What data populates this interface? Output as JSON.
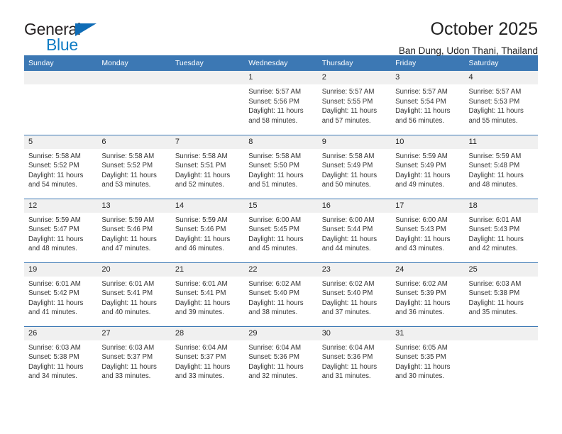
{
  "logo": {
    "word_one": "General",
    "word_two": "Blue",
    "triangle": "blue-triangle-icon",
    "accent_dark": "#231f20",
    "accent_blue": "#0f7cc4"
  },
  "header": {
    "title": "October 2025",
    "subtitle": "Ban Dung, Udon Thani, Thailand"
  },
  "theme": {
    "header_blue": "#3c78b4",
    "daynum_gray": "#f0f0f0",
    "text": "#333333"
  },
  "weekdays": [
    "Sunday",
    "Monday",
    "Tuesday",
    "Wednesday",
    "Thursday",
    "Friday",
    "Saturday"
  ],
  "weeks": [
    [
      {
        "day": "",
        "sunrise": "",
        "sunset": "",
        "daylight_line1": "",
        "daylight_line2": "",
        "empty": true
      },
      {
        "day": "",
        "sunrise": "",
        "sunset": "",
        "daylight_line1": "",
        "daylight_line2": "",
        "empty": true
      },
      {
        "day": "",
        "sunrise": "",
        "sunset": "",
        "daylight_line1": "",
        "daylight_line2": "",
        "empty": true
      },
      {
        "day": "1",
        "sunrise": "Sunrise: 5:57 AM",
        "sunset": "Sunset: 5:56 PM",
        "daylight_line1": "Daylight: 11 hours",
        "daylight_line2": "and 58 minutes.",
        "empty": false
      },
      {
        "day": "2",
        "sunrise": "Sunrise: 5:57 AM",
        "sunset": "Sunset: 5:55 PM",
        "daylight_line1": "Daylight: 11 hours",
        "daylight_line2": "and 57 minutes.",
        "empty": false
      },
      {
        "day": "3",
        "sunrise": "Sunrise: 5:57 AM",
        "sunset": "Sunset: 5:54 PM",
        "daylight_line1": "Daylight: 11 hours",
        "daylight_line2": "and 56 minutes.",
        "empty": false
      },
      {
        "day": "4",
        "sunrise": "Sunrise: 5:57 AM",
        "sunset": "Sunset: 5:53 PM",
        "daylight_line1": "Daylight: 11 hours",
        "daylight_line2": "and 55 minutes.",
        "empty": false
      }
    ],
    [
      {
        "day": "5",
        "sunrise": "Sunrise: 5:58 AM",
        "sunset": "Sunset: 5:52 PM",
        "daylight_line1": "Daylight: 11 hours",
        "daylight_line2": "and 54 minutes.",
        "empty": false
      },
      {
        "day": "6",
        "sunrise": "Sunrise: 5:58 AM",
        "sunset": "Sunset: 5:52 PM",
        "daylight_line1": "Daylight: 11 hours",
        "daylight_line2": "and 53 minutes.",
        "empty": false
      },
      {
        "day": "7",
        "sunrise": "Sunrise: 5:58 AM",
        "sunset": "Sunset: 5:51 PM",
        "daylight_line1": "Daylight: 11 hours",
        "daylight_line2": "and 52 minutes.",
        "empty": false
      },
      {
        "day": "8",
        "sunrise": "Sunrise: 5:58 AM",
        "sunset": "Sunset: 5:50 PM",
        "daylight_line1": "Daylight: 11 hours",
        "daylight_line2": "and 51 minutes.",
        "empty": false
      },
      {
        "day": "9",
        "sunrise": "Sunrise: 5:58 AM",
        "sunset": "Sunset: 5:49 PM",
        "daylight_line1": "Daylight: 11 hours",
        "daylight_line2": "and 50 minutes.",
        "empty": false
      },
      {
        "day": "10",
        "sunrise": "Sunrise: 5:59 AM",
        "sunset": "Sunset: 5:49 PM",
        "daylight_line1": "Daylight: 11 hours",
        "daylight_line2": "and 49 minutes.",
        "empty": false
      },
      {
        "day": "11",
        "sunrise": "Sunrise: 5:59 AM",
        "sunset": "Sunset: 5:48 PM",
        "daylight_line1": "Daylight: 11 hours",
        "daylight_line2": "and 48 minutes.",
        "empty": false
      }
    ],
    [
      {
        "day": "12",
        "sunrise": "Sunrise: 5:59 AM",
        "sunset": "Sunset: 5:47 PM",
        "daylight_line1": "Daylight: 11 hours",
        "daylight_line2": "and 48 minutes.",
        "empty": false
      },
      {
        "day": "13",
        "sunrise": "Sunrise: 5:59 AM",
        "sunset": "Sunset: 5:46 PM",
        "daylight_line1": "Daylight: 11 hours",
        "daylight_line2": "and 47 minutes.",
        "empty": false
      },
      {
        "day": "14",
        "sunrise": "Sunrise: 5:59 AM",
        "sunset": "Sunset: 5:46 PM",
        "daylight_line1": "Daylight: 11 hours",
        "daylight_line2": "and 46 minutes.",
        "empty": false
      },
      {
        "day": "15",
        "sunrise": "Sunrise: 6:00 AM",
        "sunset": "Sunset: 5:45 PM",
        "daylight_line1": "Daylight: 11 hours",
        "daylight_line2": "and 45 minutes.",
        "empty": false
      },
      {
        "day": "16",
        "sunrise": "Sunrise: 6:00 AM",
        "sunset": "Sunset: 5:44 PM",
        "daylight_line1": "Daylight: 11 hours",
        "daylight_line2": "and 44 minutes.",
        "empty": false
      },
      {
        "day": "17",
        "sunrise": "Sunrise: 6:00 AM",
        "sunset": "Sunset: 5:43 PM",
        "daylight_line1": "Daylight: 11 hours",
        "daylight_line2": "and 43 minutes.",
        "empty": false
      },
      {
        "day": "18",
        "sunrise": "Sunrise: 6:01 AM",
        "sunset": "Sunset: 5:43 PM",
        "daylight_line1": "Daylight: 11 hours",
        "daylight_line2": "and 42 minutes.",
        "empty": false
      }
    ],
    [
      {
        "day": "19",
        "sunrise": "Sunrise: 6:01 AM",
        "sunset": "Sunset: 5:42 PM",
        "daylight_line1": "Daylight: 11 hours",
        "daylight_line2": "and 41 minutes.",
        "empty": false
      },
      {
        "day": "20",
        "sunrise": "Sunrise: 6:01 AM",
        "sunset": "Sunset: 5:41 PM",
        "daylight_line1": "Daylight: 11 hours",
        "daylight_line2": "and 40 minutes.",
        "empty": false
      },
      {
        "day": "21",
        "sunrise": "Sunrise: 6:01 AM",
        "sunset": "Sunset: 5:41 PM",
        "daylight_line1": "Daylight: 11 hours",
        "daylight_line2": "and 39 minutes.",
        "empty": false
      },
      {
        "day": "22",
        "sunrise": "Sunrise: 6:02 AM",
        "sunset": "Sunset: 5:40 PM",
        "daylight_line1": "Daylight: 11 hours",
        "daylight_line2": "and 38 minutes.",
        "empty": false
      },
      {
        "day": "23",
        "sunrise": "Sunrise: 6:02 AM",
        "sunset": "Sunset: 5:40 PM",
        "daylight_line1": "Daylight: 11 hours",
        "daylight_line2": "and 37 minutes.",
        "empty": false
      },
      {
        "day": "24",
        "sunrise": "Sunrise: 6:02 AM",
        "sunset": "Sunset: 5:39 PM",
        "daylight_line1": "Daylight: 11 hours",
        "daylight_line2": "and 36 minutes.",
        "empty": false
      },
      {
        "day": "25",
        "sunrise": "Sunrise: 6:03 AM",
        "sunset": "Sunset: 5:38 PM",
        "daylight_line1": "Daylight: 11 hours",
        "daylight_line2": "and 35 minutes.",
        "empty": false
      }
    ],
    [
      {
        "day": "26",
        "sunrise": "Sunrise: 6:03 AM",
        "sunset": "Sunset: 5:38 PM",
        "daylight_line1": "Daylight: 11 hours",
        "daylight_line2": "and 34 minutes.",
        "empty": false
      },
      {
        "day": "27",
        "sunrise": "Sunrise: 6:03 AM",
        "sunset": "Sunset: 5:37 PM",
        "daylight_line1": "Daylight: 11 hours",
        "daylight_line2": "and 33 minutes.",
        "empty": false
      },
      {
        "day": "28",
        "sunrise": "Sunrise: 6:04 AM",
        "sunset": "Sunset: 5:37 PM",
        "daylight_line1": "Daylight: 11 hours",
        "daylight_line2": "and 33 minutes.",
        "empty": false
      },
      {
        "day": "29",
        "sunrise": "Sunrise: 6:04 AM",
        "sunset": "Sunset: 5:36 PM",
        "daylight_line1": "Daylight: 11 hours",
        "daylight_line2": "and 32 minutes.",
        "empty": false
      },
      {
        "day": "30",
        "sunrise": "Sunrise: 6:04 AM",
        "sunset": "Sunset: 5:36 PM",
        "daylight_line1": "Daylight: 11 hours",
        "daylight_line2": "and 31 minutes.",
        "empty": false
      },
      {
        "day": "31",
        "sunrise": "Sunrise: 6:05 AM",
        "sunset": "Sunset: 5:35 PM",
        "daylight_line1": "Daylight: 11 hours",
        "daylight_line2": "and 30 minutes.",
        "empty": false
      },
      {
        "day": "",
        "sunrise": "",
        "sunset": "",
        "daylight_line1": "",
        "daylight_line2": "",
        "empty": true
      }
    ]
  ]
}
